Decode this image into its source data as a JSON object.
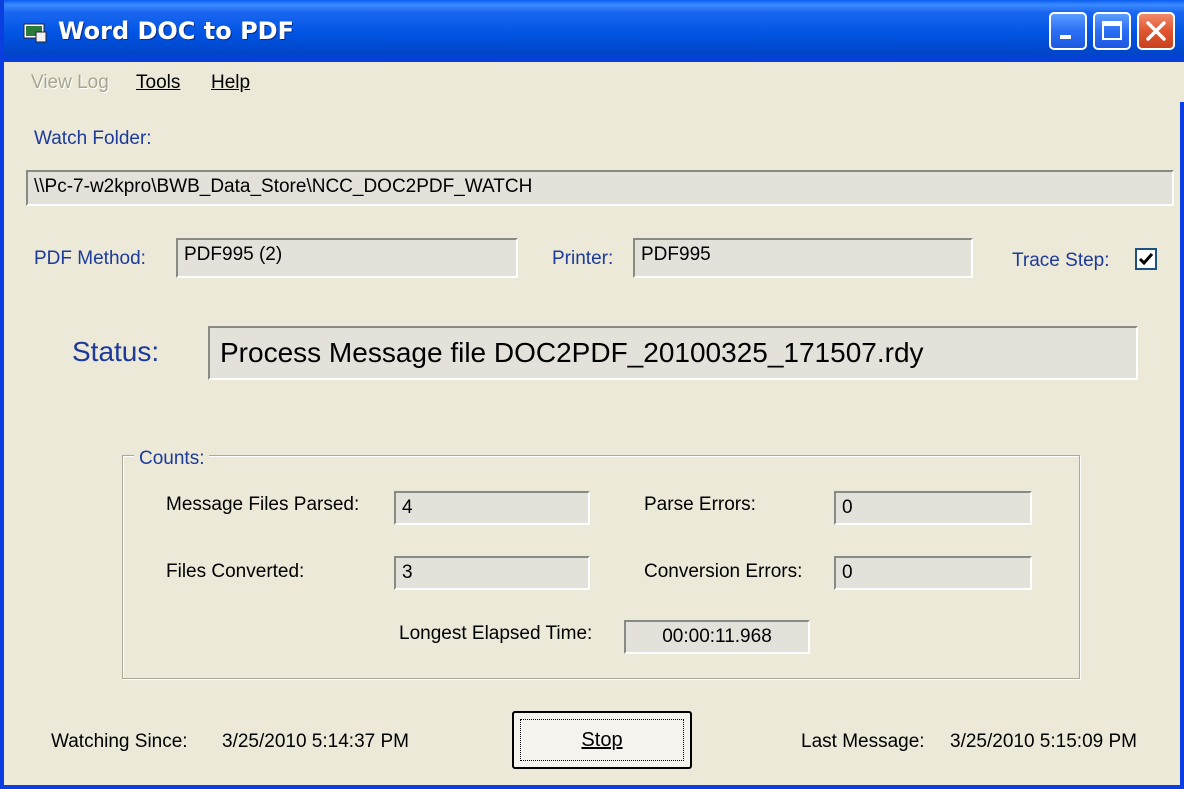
{
  "window": {
    "title": "Word DOC to PDF",
    "controls": [
      "minimize",
      "maximize",
      "close"
    ]
  },
  "menu": {
    "view_log": "View Log",
    "tools": "Tools",
    "help": "Help"
  },
  "watch_folder": {
    "label": "Watch Folder:",
    "value": "\\\\Pc-7-w2kpro\\BWB_Data_Store\\NCC_DOC2PDF_WATCH"
  },
  "pdf_method": {
    "label": "PDF Method:",
    "value": "PDF995 (2)"
  },
  "printer": {
    "label": "Printer:",
    "value": "PDF995"
  },
  "trace_step": {
    "label": "Trace Step:",
    "checked": true,
    "mark": "✓"
  },
  "status": {
    "label": "Status:",
    "value": "Process Message file DOC2PDF_20100325_171507.rdy"
  },
  "counts": {
    "legend": "Counts:",
    "message_files_parsed": {
      "label": "Message Files Parsed:",
      "value": "4"
    },
    "parse_errors": {
      "label": "Parse Errors:",
      "value": "0"
    },
    "files_converted": {
      "label": "Files Converted:",
      "value": "3"
    },
    "conversion_errors": {
      "label": "Conversion Errors:",
      "value": "0"
    },
    "longest_elapsed": {
      "label": "Longest Elapsed Time:",
      "value": "00:00:11.968"
    }
  },
  "footer": {
    "watching_since_label": "Watching Since:",
    "watching_since_value": "3/25/2010 5:14:37 PM",
    "stop_label": "Stop",
    "last_message_label": "Last Message:",
    "last_message_value": "3/25/2010 5:15:09 PM"
  },
  "colors": {
    "titlebar": "#0054e3",
    "face": "#ece9d8",
    "label_blue": "#1b3a9a",
    "close_red": "#e05532"
  }
}
